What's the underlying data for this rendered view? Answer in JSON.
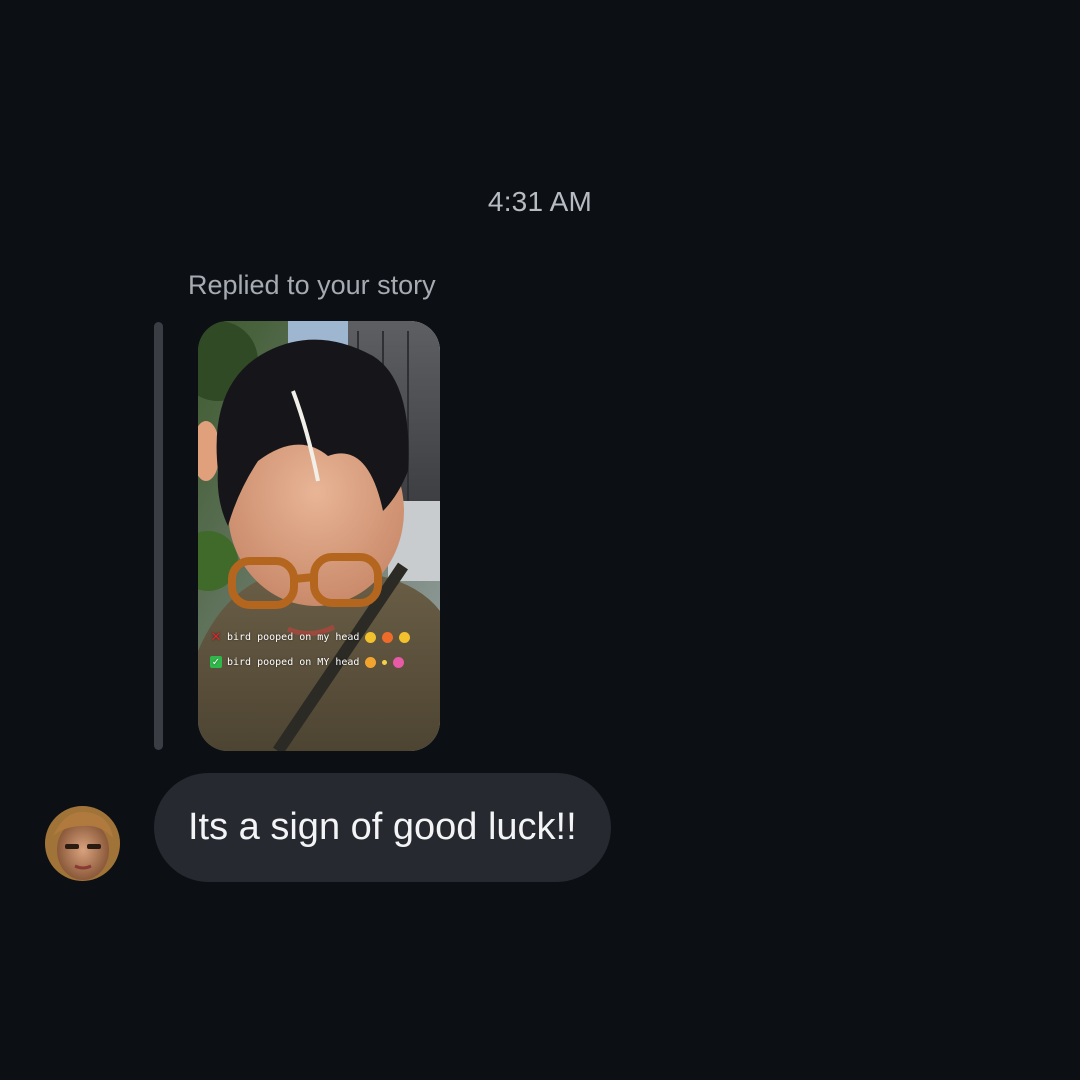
{
  "thread": {
    "timestamp": "4:31 AM",
    "reply_caption": "Replied to your story",
    "story": {
      "overlay_lines": [
        {
          "mark": "cross-mark-icon",
          "text": "bird pooped on my head"
        },
        {
          "mark": "check-mark-icon",
          "text": "bird pooped on MY head"
        }
      ]
    },
    "message": {
      "text": "Its a sign of good luck!!"
    }
  },
  "colors": {
    "background": "#0c0f14",
    "bubble": "#26292f",
    "quote_bar": "#3a3d43",
    "text_primary": "#f3f4f6",
    "text_secondary": "#a6aab1"
  }
}
